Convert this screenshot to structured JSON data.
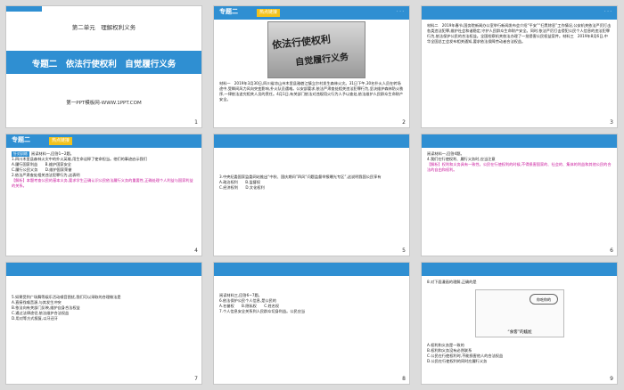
{
  "slides": [
    {
      "unit": "第二单元　理解权利义务",
      "title": "专题二　依法行使权利　自觉履行义务",
      "site": "第一PPT模板网-WWW.1PPT.COM",
      "page": "1"
    },
    {
      "header": "专题二",
      "tag": "热点链接",
      "calligraphy_1": "依法行使权利",
      "calligraphy_2": "自觉履行义务",
      "text": "材料一　2019年3月30日,四川省凉山州木里县雅砻江镇立尔村发生森林火灾。31日下午,30名扑火人员在转场途中,受瞬间风力风向突变影响,扑火队员遇难。公安部要求,依法严肃查处相关违法犯罪行为,坚决维护森林防火秩序,一律依法追究相关人员的责任。4月1日,有关部门依法对违规用火行为人予以查处,依法维护人民群众生命财产安全。",
      "page": "2"
    },
    {
      "text": "材料二　2019年春节,国务院新闻办公室举行新闻发布会介绍“平安”“扫黑除恶”工作情况,公安机关依法严厉打击各类违法犯罪,维护社会和谐稳定,守护人民群众生命财产安全。同时,依法严厉打击侵犯公民个人信息的违法犯罪行为,依法保护公民的合法权益。全国检察机关依法办理了一批侵害公民权益案件。材料三　2019年8月6日,中华全国总工会发布相关通知,要求依法保障劳动者合法权益。",
      "page": "3"
    },
    {
      "header": "专题二",
      "tag": "热点链接",
      "label": "针对训练",
      "text": "阅读材料一,回答1~2题。",
      "q1": "1.四川木里县森林火灾中的扑火英雄,用生命诠释了使命担当。他们的事迹启示我们",
      "opts": [
        "A.履行国家利益　　B.维护国家安全",
        "C.履行公民义务　　D.维护国家荣誉"
      ],
      "q2": "2.依法严肃查处相关违法犯罪行为,这表明",
      "analysis": "【解析】本题考查公民的基本义务,要求学生正确认识公民依法履行义务的重要性,正确处理个人利益与国家利益的关系。",
      "page": "4"
    },
    {
      "text": "3.中央纪委国家监委网站推出“中秋、国庆期间”四风“问题监督举报曝光专区”,这说明我国公民享有",
      "opts": [
        "A.政治权利　　B.监督权",
        "C.经济权利　　D.文化权利"
      ],
      "page": "5"
    },
    {
      "text": "阅读材料一,回答4题。",
      "q4": "4.我们在行使权利、履行义务时,应当注意",
      "analysis": "【解析】权利和义务具有一致性。公民在行使权利的时候,不得损害国家的、社会的、集体的利益和其他公民的合法的自由和权利。",
      "page": "6"
    },
    {
      "text": "5.如果受到广场舞等娱乐活动噪音困扰,我们可以采取的合理做法是",
      "opts": [
        "A.直接找噪音源,与其发生冲突",
        "B.依法向有关部门反映,维护自身合法权益",
        "C.通过法律途径,依法维护合法权益",
        "D.用对等方式报复,以牙还牙"
      ],
      "page": "7"
    },
    {
      "text": "阅读材料三,回答6~7题。",
      "q6": "6.依法保护公民个人信息,是公民的",
      "opts": [
        "A.名誉权　　B.隐私权　　C.姓名权"
      ],
      "q7": "7.个人信息安全关系到人民群众切身利益。公民应当",
      "page": "8"
    },
    {
      "text": "8.对下面漫画的理解,正确的是",
      "caption": "“食客”的尴尬",
      "speech": "你吃你的",
      "opts": [
        "A.权利和义务是一致的",
        "B.权利和义务没有必然联系",
        "C.公民在行使权利时,不能损害他人的合法权益",
        "D.公民在行使权利的同时应履行义务"
      ],
      "page": "9"
    }
  ]
}
